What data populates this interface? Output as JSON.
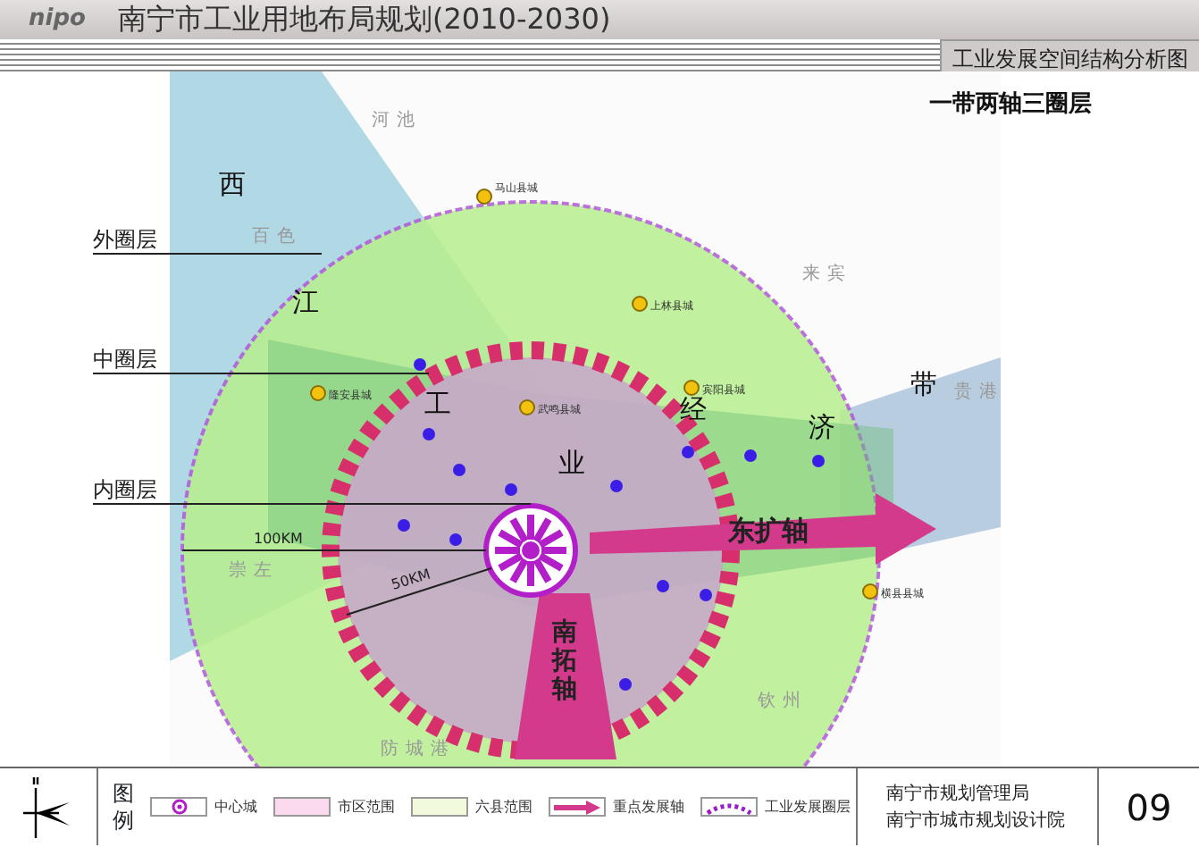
{
  "header": {
    "logo": "nipo",
    "title": "南宁市工业用地布局规划(2010-2030)",
    "subtitle": "工业发展空间结构分析图"
  },
  "map": {
    "heading": "一带两轴三圈层",
    "ring_labels": [
      "外圈层",
      "中圈层",
      "内圈层"
    ],
    "belt_chars": [
      "西",
      "江",
      "工",
      "业",
      "经",
      "济",
      "带"
    ],
    "axes": [
      {
        "kind": "east",
        "label": "东扩轴"
      },
      {
        "kind": "south",
        "label": "南拓轴"
      }
    ],
    "distances": [
      "100KM",
      "50KM"
    ],
    "regions": [
      "河池",
      "百色",
      "来宾",
      "贵港",
      "崇左",
      "钦州",
      "防城港"
    ],
    "county_towns": [
      "马山县城",
      "隆安县城",
      "武鸣县城",
      "上林县城",
      "宾阳县城",
      "横县县城"
    ]
  },
  "legend": {
    "title": "图例",
    "items": [
      {
        "kind": "center",
        "label": "中心城"
      },
      {
        "kind": "urban",
        "label": "市区范围"
      },
      {
        "kind": "county",
        "label": "六县范围"
      },
      {
        "kind": "axis",
        "label": "重点发展轴"
      },
      {
        "kind": "ring",
        "label": "工业发展圈层"
      }
    ]
  },
  "organizations": [
    "南宁市规划管理局",
    "南宁市城市规划设计院"
  ],
  "page_number": "09"
}
